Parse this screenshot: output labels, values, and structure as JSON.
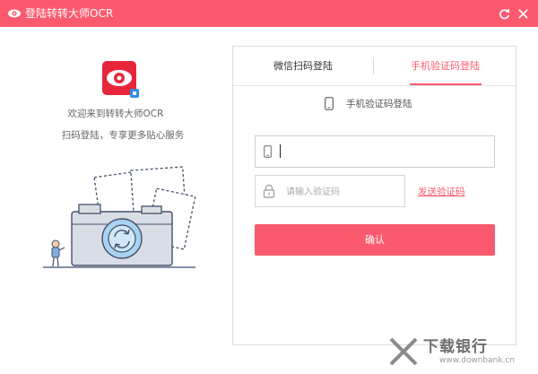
{
  "window": {
    "title": "登陆转转大师OCR",
    "accent": "#fb5a6e"
  },
  "left": {
    "welcome": "欢迎来到转转大师OCR",
    "subtext": "扫码登陆，专享更多贴心服务"
  },
  "tabs": [
    {
      "label": "微信扫码登陆",
      "active": false
    },
    {
      "label": "手机验证码登陆",
      "active": true
    }
  ],
  "form": {
    "heading": "手机验证码登陆",
    "phone_value": "",
    "code_placeholder": "请输入验证码",
    "send_code_label": "发送验证码",
    "confirm_label": "确认"
  },
  "watermark": {
    "text": "下载银行",
    "url": "www.downbank.cn"
  }
}
